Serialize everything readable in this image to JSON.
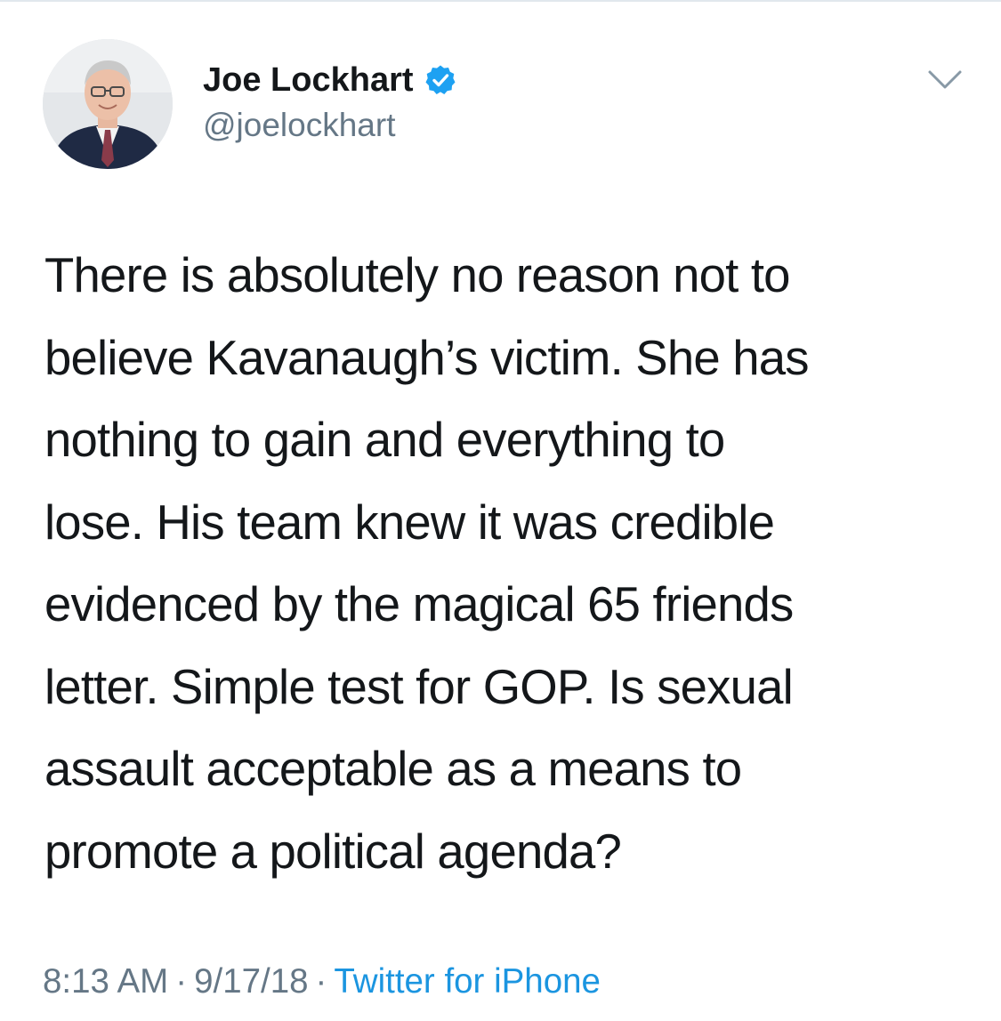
{
  "tweet": {
    "author": {
      "display_name": "Joe Lockhart",
      "handle": "@joelockhart",
      "verified": true,
      "avatar_icon": "profile-photo"
    },
    "text_lines": [
      "There is absolutely no reason not to",
      "believe Kavanaugh’s victim. She has",
      "nothing to gain and everything to",
      "lose. His team knew it was credible",
      "evidenced by the magical 65 friends",
      "letter. Simple test for GOP. Is sexual",
      "assault acceptable as a means to",
      "promote a political agenda?"
    ],
    "time": "8:13 AM",
    "date": "9/17/18",
    "separator": "·",
    "source": "Twitter for iPhone",
    "menu_icon": "chevron-down-icon",
    "verified_icon": "verified-badge-icon"
  },
  "colors": {
    "text_primary": "#14171a",
    "text_secondary": "#657786",
    "link": "#1b95e0",
    "verified_badge": "#1da1f2",
    "divider": "#e1e8ed"
  }
}
